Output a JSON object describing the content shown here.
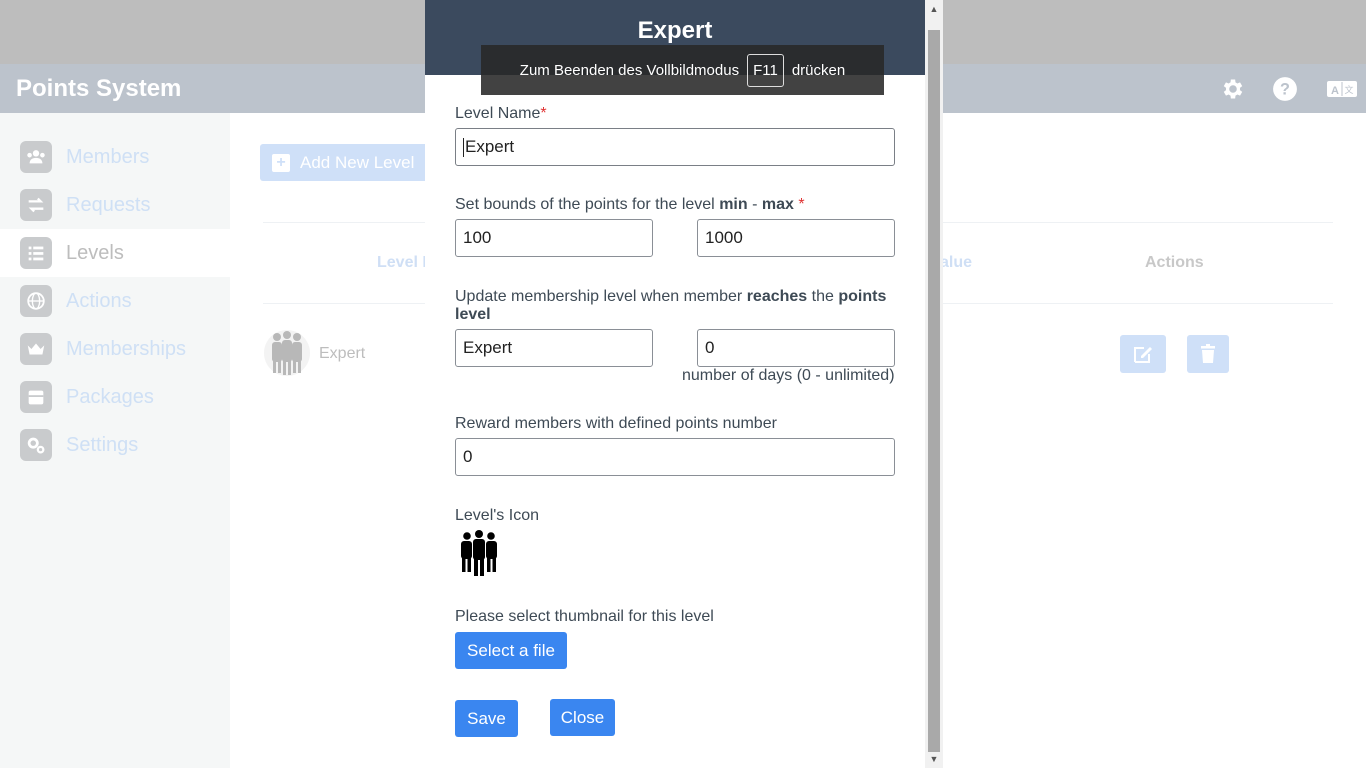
{
  "app": {
    "title": "Points System"
  },
  "sidebar": {
    "items": [
      {
        "label": "Members",
        "icon": "users-icon"
      },
      {
        "label": "Requests",
        "icon": "exchange-icon"
      },
      {
        "label": "Levels",
        "icon": "list-icon",
        "active": true
      },
      {
        "label": "Actions",
        "icon": "globe-icon"
      },
      {
        "label": "Memberships",
        "icon": "crown-icon"
      },
      {
        "label": "Packages",
        "icon": "package-icon"
      },
      {
        "label": "Settings",
        "icon": "gears-icon"
      }
    ]
  },
  "main": {
    "add_button": "Add New Level",
    "columns": {
      "level": "Level N",
      "value": "alue",
      "actions": "Actions"
    },
    "rows": [
      {
        "name": "Expert"
      }
    ]
  },
  "fullscreen_toast": {
    "before": "Zum Beenden des Vollbildmodus",
    "key": "F11",
    "after": "drücken"
  },
  "modal": {
    "title": "Expert",
    "level_name_label": "Level Name",
    "level_name_value": "Expert",
    "bounds_label_prefix": "Set bounds of the points for the level",
    "bounds_min_word": "min",
    "bounds_sep": "-",
    "bounds_max_word": "max",
    "min_value": "100",
    "max_value": "1000",
    "update_label_1": "Update membership level when member",
    "update_label_reaches": "reaches",
    "update_label_the": "the",
    "update_label_points": "points",
    "update_label_level": "level",
    "membership_value": "Expert",
    "days_value": "0",
    "days_hint": "number of days (0 - unlimited)",
    "reward_label": "Reward members with defined points number",
    "reward_value": "0",
    "icon_label": "Level's Icon",
    "thumbnail_label": "Please select thumbnail for this level",
    "select_file_button": "Select a file",
    "save_button": "Save",
    "close_button": "Close",
    "required_mark": "*"
  }
}
